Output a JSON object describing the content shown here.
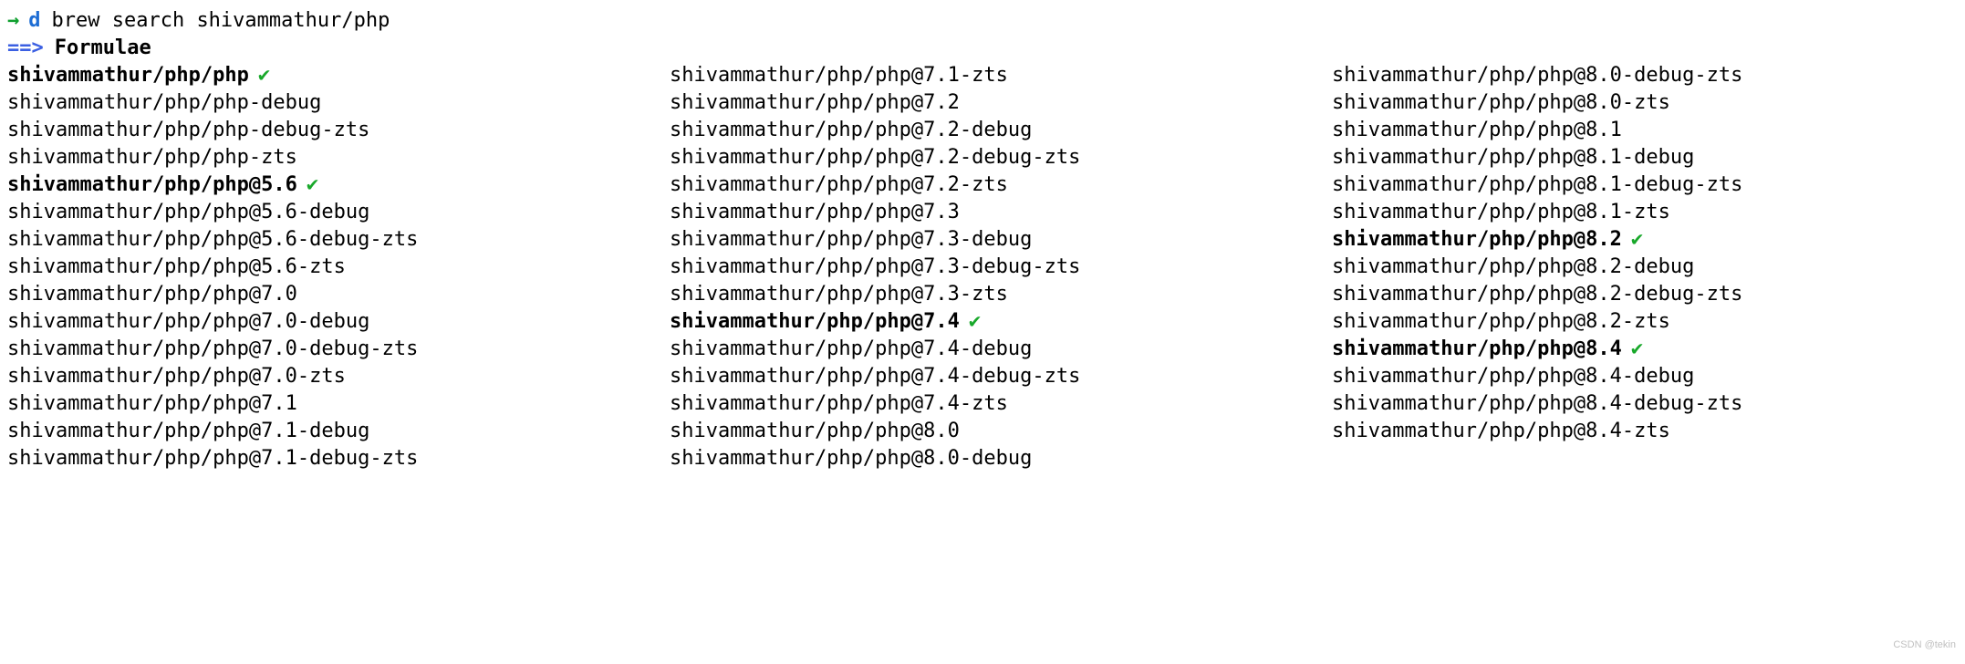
{
  "prompt": {
    "arrow": "→",
    "dir": "d",
    "command": "brew search shivammathur/php"
  },
  "header": {
    "arrow": "==>",
    "section": "Formulae"
  },
  "check_mark": "✔",
  "columns": [
    [
      {
        "name": "shivammathur/php/php",
        "installed": true
      },
      {
        "name": "shivammathur/php/php-debug",
        "installed": false
      },
      {
        "name": "shivammathur/php/php-debug-zts",
        "installed": false
      },
      {
        "name": "shivammathur/php/php-zts",
        "installed": false
      },
      {
        "name": "shivammathur/php/php@5.6",
        "installed": true
      },
      {
        "name": "shivammathur/php/php@5.6-debug",
        "installed": false
      },
      {
        "name": "shivammathur/php/php@5.6-debug-zts",
        "installed": false
      },
      {
        "name": "shivammathur/php/php@5.6-zts",
        "installed": false
      },
      {
        "name": "shivammathur/php/php@7.0",
        "installed": false
      },
      {
        "name": "shivammathur/php/php@7.0-debug",
        "installed": false
      },
      {
        "name": "shivammathur/php/php@7.0-debug-zts",
        "installed": false
      },
      {
        "name": "shivammathur/php/php@7.0-zts",
        "installed": false
      },
      {
        "name": "shivammathur/php/php@7.1",
        "installed": false
      },
      {
        "name": "shivammathur/php/php@7.1-debug",
        "installed": false
      },
      {
        "name": "shivammathur/php/php@7.1-debug-zts",
        "installed": false
      }
    ],
    [
      {
        "name": "shivammathur/php/php@7.1-zts",
        "installed": false
      },
      {
        "name": "shivammathur/php/php@7.2",
        "installed": false
      },
      {
        "name": "shivammathur/php/php@7.2-debug",
        "installed": false
      },
      {
        "name": "shivammathur/php/php@7.2-debug-zts",
        "installed": false
      },
      {
        "name": "shivammathur/php/php@7.2-zts",
        "installed": false
      },
      {
        "name": "shivammathur/php/php@7.3",
        "installed": false
      },
      {
        "name": "shivammathur/php/php@7.3-debug",
        "installed": false
      },
      {
        "name": "shivammathur/php/php@7.3-debug-zts",
        "installed": false
      },
      {
        "name": "shivammathur/php/php@7.3-zts",
        "installed": false
      },
      {
        "name": "shivammathur/php/php@7.4",
        "installed": true
      },
      {
        "name": "shivammathur/php/php@7.4-debug",
        "installed": false
      },
      {
        "name": "shivammathur/php/php@7.4-debug-zts",
        "installed": false
      },
      {
        "name": "shivammathur/php/php@7.4-zts",
        "installed": false
      },
      {
        "name": "shivammathur/php/php@8.0",
        "installed": false
      },
      {
        "name": "shivammathur/php/php@8.0-debug",
        "installed": false
      }
    ],
    [
      {
        "name": "shivammathur/php/php@8.0-debug-zts",
        "installed": false
      },
      {
        "name": "shivammathur/php/php@8.0-zts",
        "installed": false
      },
      {
        "name": "shivammathur/php/php@8.1",
        "installed": false
      },
      {
        "name": "shivammathur/php/php@8.1-debug",
        "installed": false
      },
      {
        "name": "shivammathur/php/php@8.1-debug-zts",
        "installed": false
      },
      {
        "name": "shivammathur/php/php@8.1-zts",
        "installed": false
      },
      {
        "name": "shivammathur/php/php@8.2",
        "installed": true
      },
      {
        "name": "shivammathur/php/php@8.2-debug",
        "installed": false
      },
      {
        "name": "shivammathur/php/php@8.2-debug-zts",
        "installed": false
      },
      {
        "name": "shivammathur/php/php@8.2-zts",
        "installed": false
      },
      {
        "name": "shivammathur/php/php@8.4",
        "installed": true
      },
      {
        "name": "shivammathur/php/php@8.4-debug",
        "installed": false
      },
      {
        "name": "shivammathur/php/php@8.4-debug-zts",
        "installed": false
      },
      {
        "name": "shivammathur/php/php@8.4-zts",
        "installed": false
      }
    ]
  ],
  "watermark": "CSDN @tekin"
}
